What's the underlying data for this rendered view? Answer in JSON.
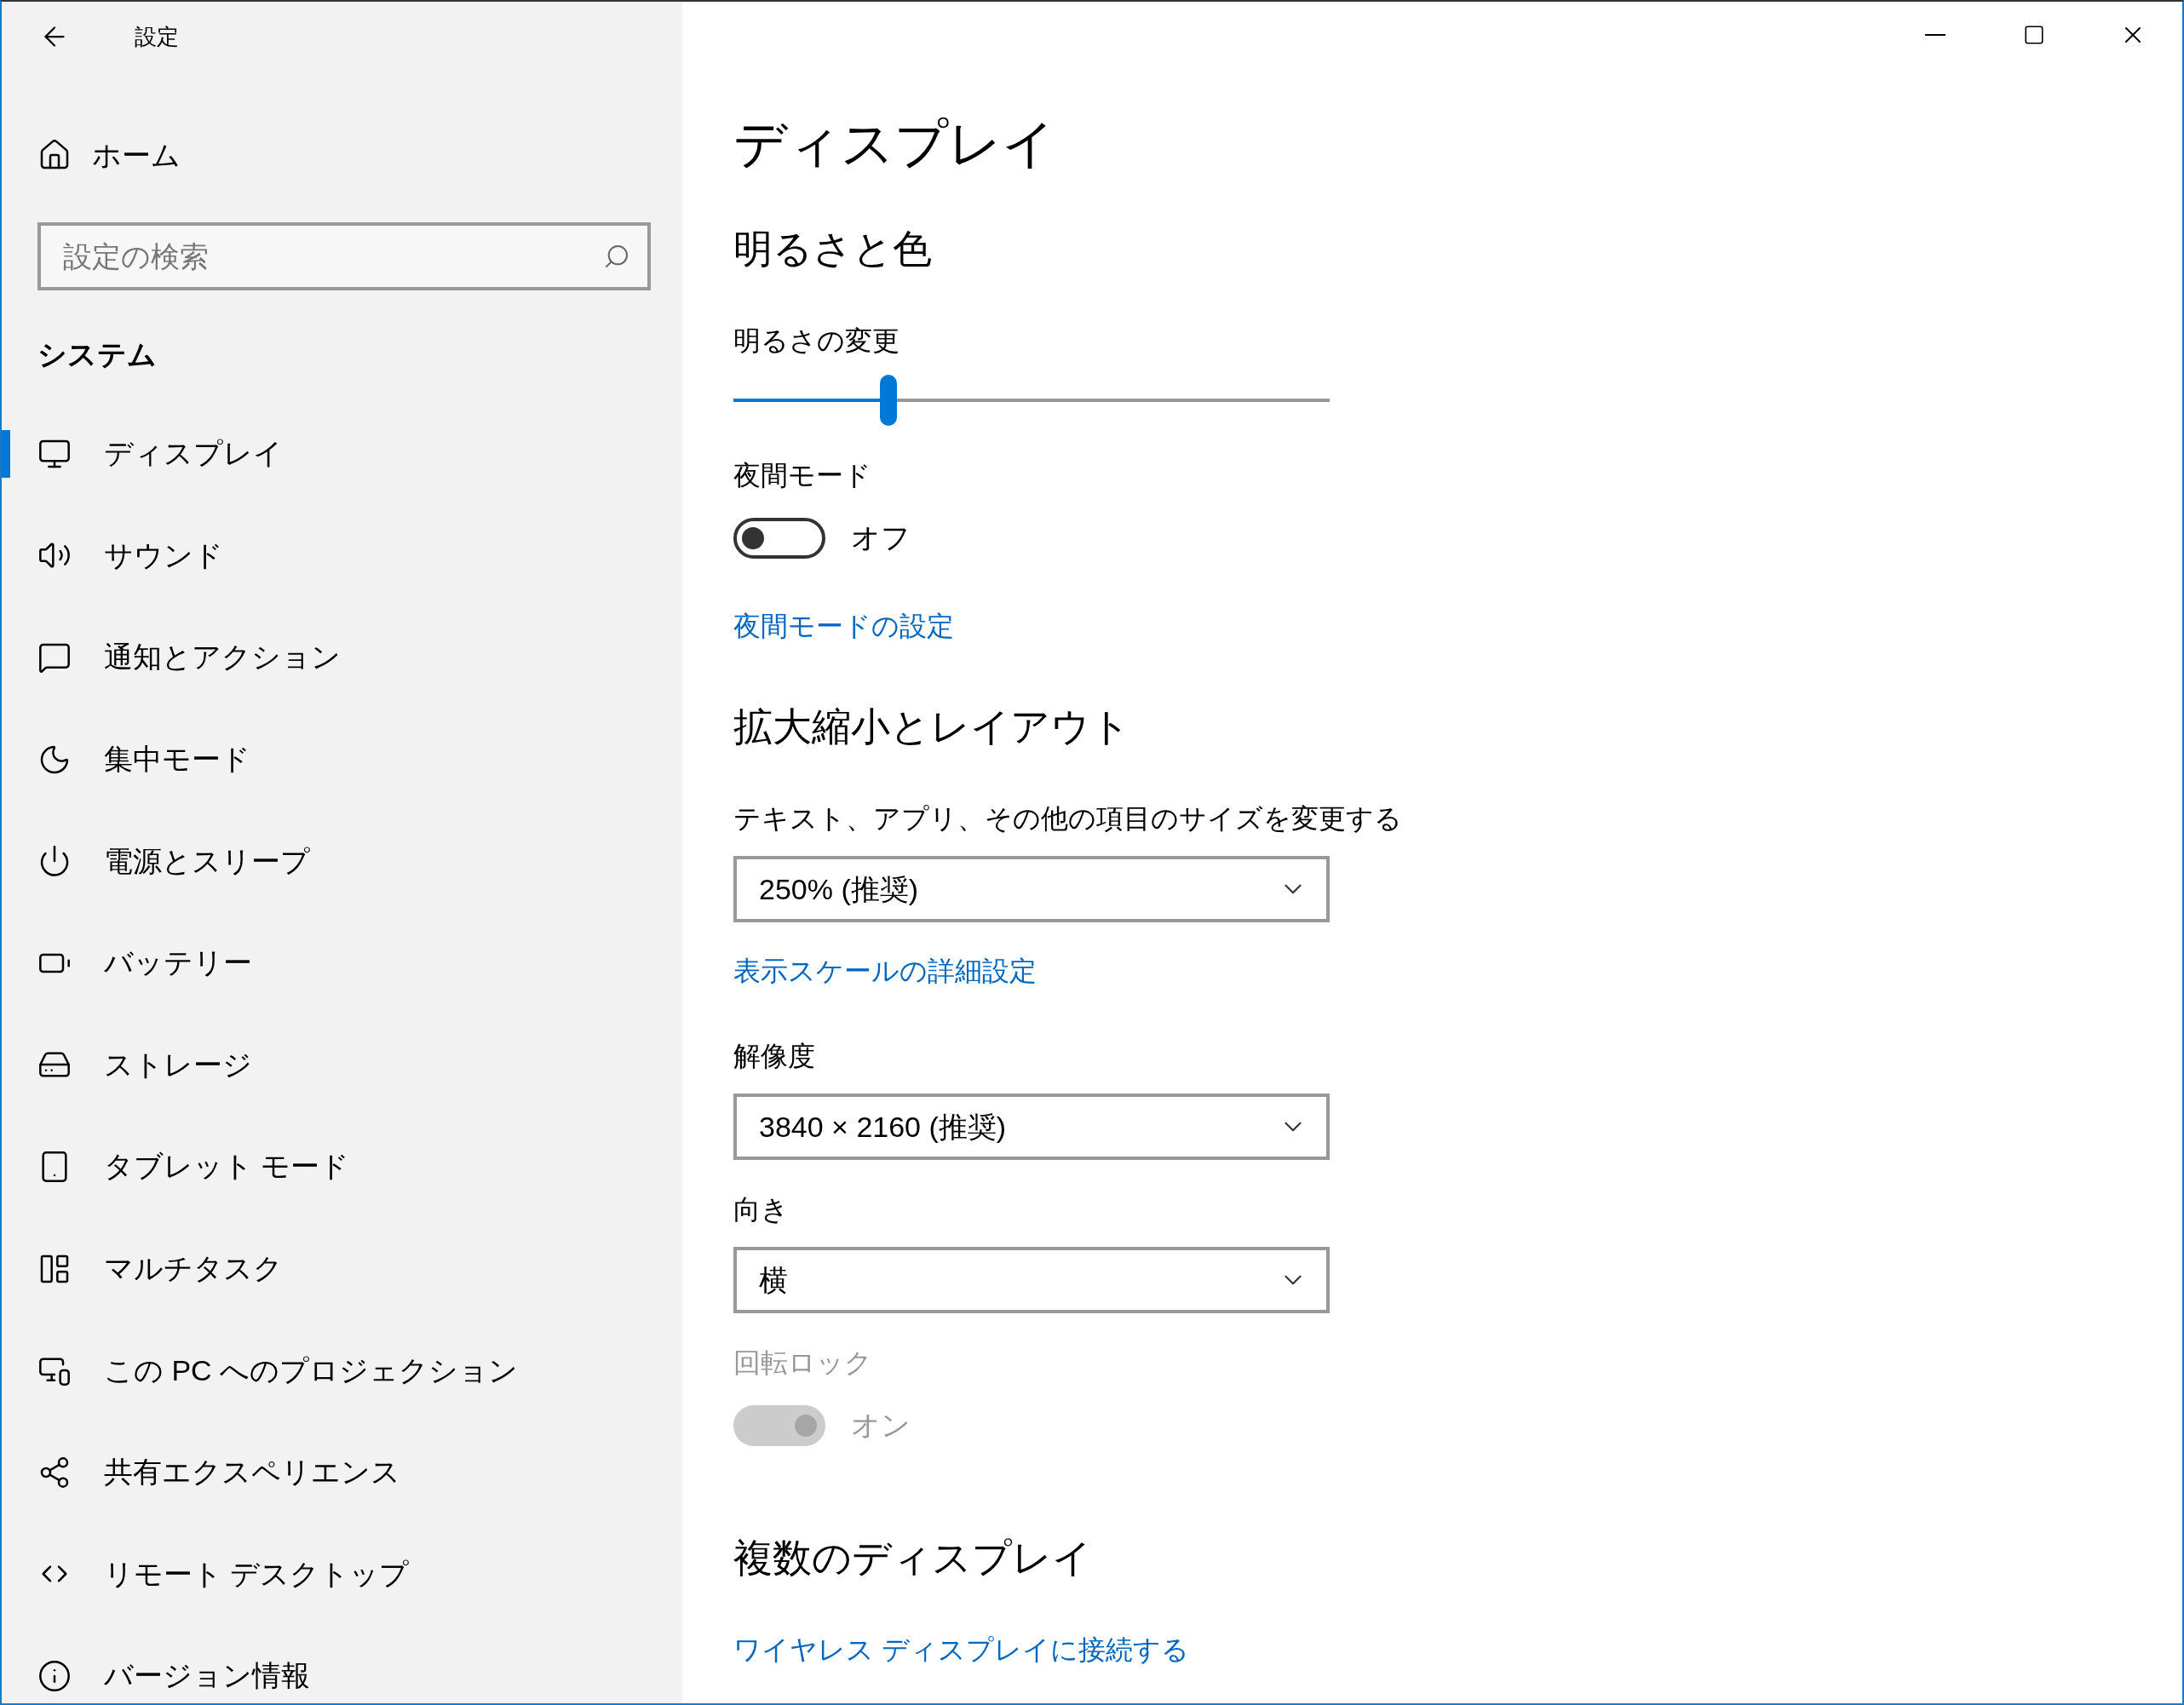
{
  "window": {
    "title": "設定"
  },
  "sidebar": {
    "home": "ホーム",
    "search": {
      "placeholder": "設定の検索"
    },
    "section": "システム",
    "items": [
      {
        "label": "ディスプレイ",
        "selected": true
      },
      {
        "label": "サウンド",
        "selected": false
      },
      {
        "label": "通知とアクション",
        "selected": false
      },
      {
        "label": "集中モード",
        "selected": false
      },
      {
        "label": "電源とスリープ",
        "selected": false
      },
      {
        "label": "バッテリー",
        "selected": false
      },
      {
        "label": "ストレージ",
        "selected": false
      },
      {
        "label": "タブレット モード",
        "selected": false
      },
      {
        "label": "マルチタスク",
        "selected": false
      },
      {
        "label": "この PC へのプロジェクション",
        "selected": false
      },
      {
        "label": "共有エクスペリエンス",
        "selected": false
      },
      {
        "label": "リモート デスクトップ",
        "selected": false
      },
      {
        "label": "バージョン情報",
        "selected": false
      }
    ]
  },
  "page": {
    "title": "ディスプレイ",
    "sections": [
      {
        "heading": "明るさと色",
        "controls": [
          {
            "kind": "slider",
            "label": "明るさの変更",
            "level": 0.26
          },
          {
            "kind": "toggle",
            "label": "夜間モード",
            "on": false,
            "disabled": false,
            "state_text": "オフ"
          },
          {
            "kind": "link",
            "text": "夜間モードの設定"
          }
        ]
      },
      {
        "heading": "拡大縮小とレイアウト",
        "controls": [
          {
            "kind": "dropdown",
            "label": "テキスト、アプリ、その他の項目のサイズを変更する",
            "value": "250% (推奨)"
          },
          {
            "kind": "link",
            "text": "表示スケールの詳細設定"
          },
          {
            "kind": "dropdown",
            "label": "解像度",
            "value": "3840 × 2160 (推奨)"
          },
          {
            "kind": "dropdown",
            "label": "向き",
            "value": "横"
          },
          {
            "kind": "toggle",
            "label": "回転ロック",
            "on": true,
            "disabled": true,
            "state_text": "オン"
          }
        ]
      },
      {
        "heading": "複数のディスプレイ",
        "controls": [
          {
            "kind": "link",
            "text": "ワイヤレス ディスプレイに接続する"
          }
        ]
      }
    ]
  }
}
